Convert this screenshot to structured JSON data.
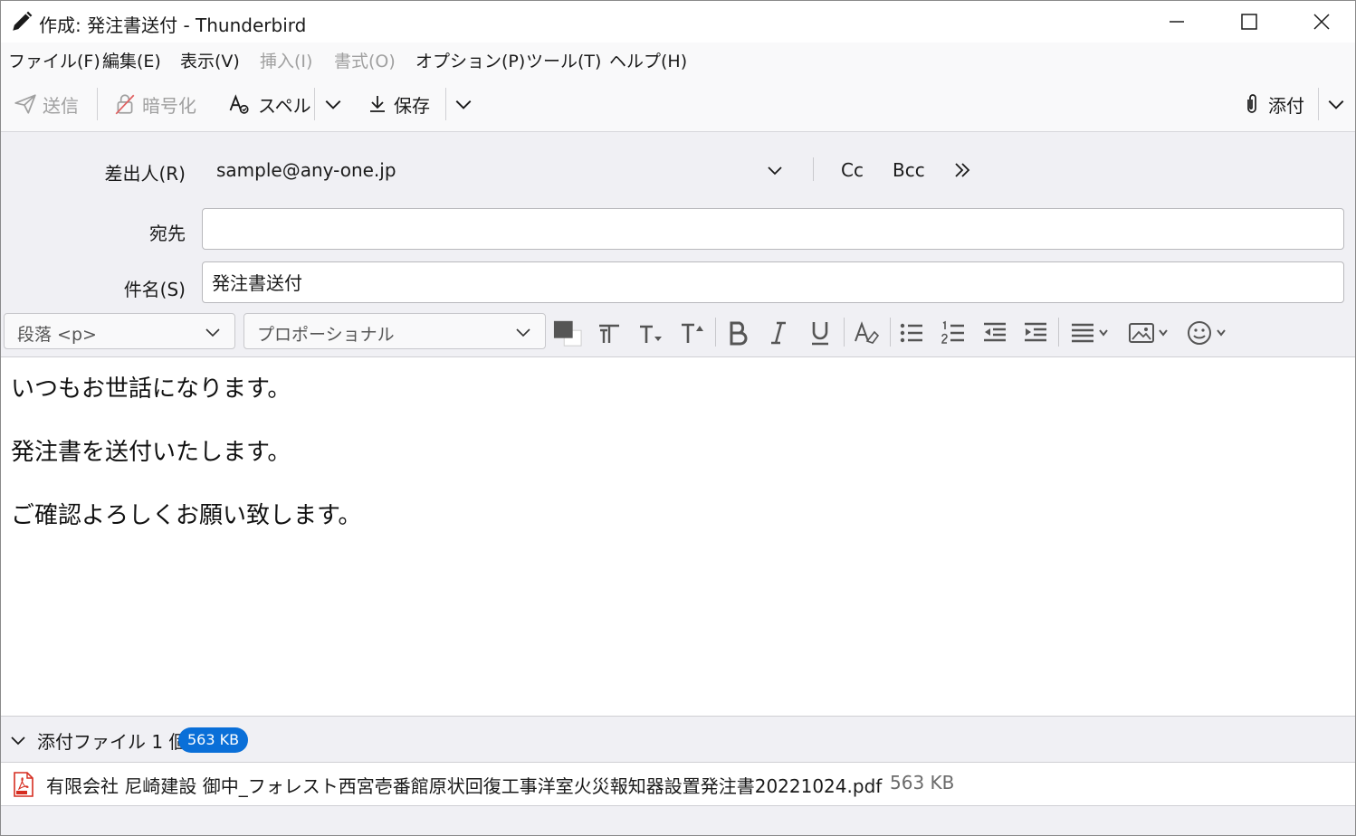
{
  "window": {
    "title": "作成: 発注書送付 - Thunderbird"
  },
  "menu": [
    {
      "label": "ファイル(F)",
      "enabled": true
    },
    {
      "label": "編集(E)",
      "enabled": true
    },
    {
      "label": "表示(V)",
      "enabled": true
    },
    {
      "label": "挿入(I)",
      "enabled": false
    },
    {
      "label": "書式(O)",
      "enabled": false
    },
    {
      "label": "オプション(P)",
      "enabled": true
    },
    {
      "label": "ツール(T)",
      "enabled": true
    },
    {
      "label": "ヘルプ(H)",
      "enabled": true
    }
  ],
  "toolbar": {
    "send_label": "送信",
    "encrypt_label": "暗号化",
    "spell_label": "スペル",
    "save_label": "保存",
    "attach_label": "添付"
  },
  "headers": {
    "from_label": "差出人(R)",
    "from_value": "sample@any-one.jp",
    "cc_label": "Cc",
    "bcc_label": "Bcc",
    "to_label": "宛先",
    "to_value": "",
    "subject_label": "件名(S)",
    "subject_value": "発注書送付"
  },
  "format": {
    "paragraph_label": "段落 <p>",
    "font_label": "プロポーショナル"
  },
  "body": {
    "paragraphs": [
      "いつもお世話になります。",
      "発注書を送付いたします。",
      "ご確認よろしくお願い致します。"
    ]
  },
  "attachments": {
    "header_label": "添付ファイル 1 個",
    "total_size": "563 KB",
    "items": [
      {
        "name": "有限会社 尼崎建設 御中_フォレスト西宮壱番館原状回復工事洋室火災報知器設置発注書20221024.pdf",
        "size": "563 KB"
      }
    ]
  },
  "colors": {
    "accent": "#0a6fd8",
    "chrome": "#f0f0f4",
    "pdf_icon": "#d62d20"
  }
}
